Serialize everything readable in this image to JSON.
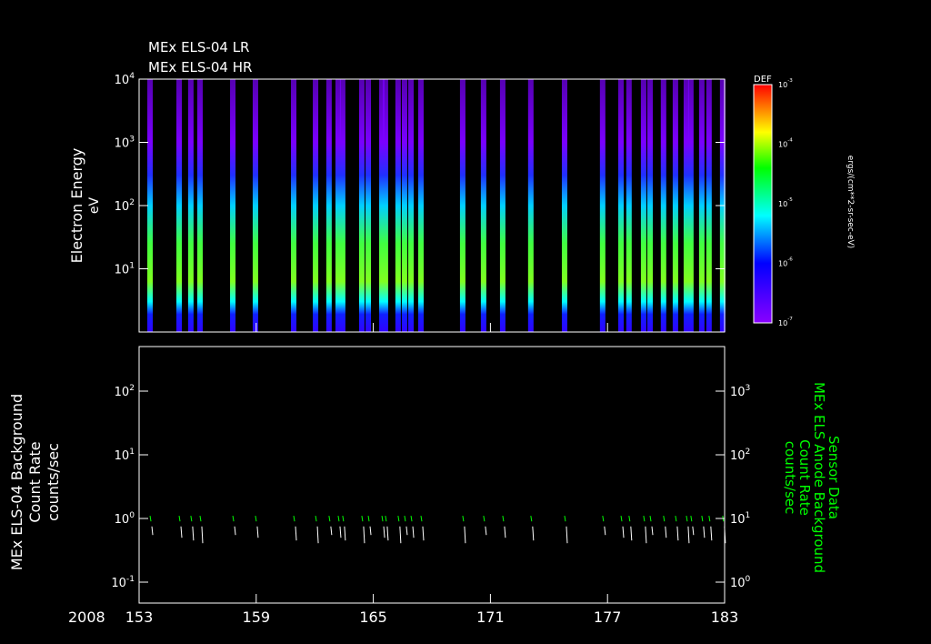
{
  "chart_data": [
    {
      "type": "heatmap",
      "title_lines": [
        "MEx ELS-04 LR",
        "MEx ELS-04 HR"
      ],
      "ylabel": "Electron Energy",
      "yunit": "eV",
      "yscale": "log",
      "ylim": [
        1,
        10000
      ],
      "yticks": [
        {
          "b": "10",
          "e": "4",
          "v": 10000
        },
        {
          "b": "10",
          "e": "3",
          "v": 1000
        },
        {
          "b": "10",
          "e": "2",
          "v": 100
        },
        {
          "b": "10",
          "e": "1",
          "v": 10
        }
      ],
      "xlim": [
        153,
        183
      ],
      "colorbar": {
        "label": "DEF",
        "unit": "ergs/(cm**2-sr-sec-eV)",
        "range": [
          1e-07,
          0.001
        ],
        "ticks": [
          {
            "b": "10",
            "e": "-3",
            "v": -3
          },
          {
            "b": "10",
            "e": "-4",
            "v": -4
          },
          {
            "b": "10",
            "e": "-5",
            "v": -5
          },
          {
            "b": "10",
            "e": "-6",
            "v": -6
          },
          {
            "b": "10",
            "e": "-7",
            "v": -7
          }
        ]
      },
      "burst_days": [
        153.56,
        155.05,
        155.65,
        156.12,
        157.8,
        158.96,
        160.92,
        162.04,
        162.73,
        163.2,
        163.43,
        164.41,
        164.74,
        165.44,
        165.62,
        166.27,
        166.6,
        166.93,
        167.44,
        169.58,
        170.65,
        171.63,
        173.07,
        174.8,
        176.75,
        177.69,
        178.1,
        178.85,
        179.18,
        179.87,
        180.48,
        181.04,
        181.27,
        181.83,
        182.2,
        182.9
      ]
    },
    {
      "type": "line",
      "ylabel_lines": [
        "MEx ELS-04 Background",
        "Count Rate",
        "counts/sec"
      ],
      "ylabel_right_lines": [
        "Sensor Data",
        "MEx ELS Anode Background",
        "Count Rate",
        "counts/sec"
      ],
      "yscale": "log",
      "ylim": [
        0.05,
        500
      ],
      "ylim_right": [
        0.5,
        5000
      ],
      "yticks": [
        {
          "b": "10",
          "e": "2",
          "v": 100
        },
        {
          "b": "10",
          "e": "1",
          "v": 10
        },
        {
          "b": "10",
          "e": "0",
          "v": 1
        },
        {
          "b": "10",
          "e": "-1",
          "v": 0.1
        }
      ],
      "yticks_right": [
        {
          "b": "10",
          "e": "3",
          "v": 1000
        },
        {
          "b": "10",
          "e": "2",
          "v": 100
        },
        {
          "b": "10",
          "e": "1",
          "v": 10
        },
        {
          "b": "10",
          "e": "0",
          "v": 1
        }
      ],
      "xlabel_year": "2008",
      "xticks": [
        153,
        159,
        165,
        171,
        177,
        183
      ],
      "series": [
        {
          "name": "Background Count Rate",
          "color": "#ffffff",
          "value_low": 0.55,
          "value_high": 0.75
        },
        {
          "name": "Anode Background Count Rate",
          "color": "#00ff00",
          "value_low": 9,
          "value_high": 11
        }
      ]
    }
  ]
}
